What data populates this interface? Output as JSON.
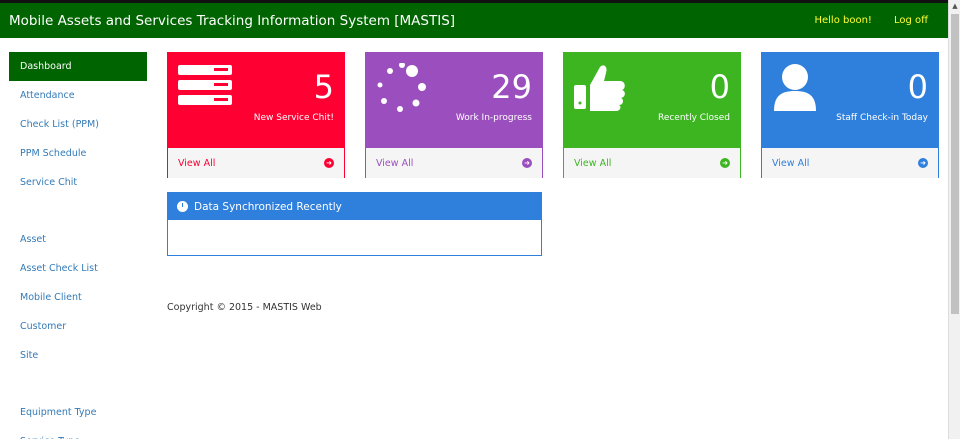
{
  "header": {
    "title": "Mobile Assets and Services Tracking Information System [MASTIS]",
    "greeting": "Hello boon!",
    "logout": "Log off"
  },
  "sidebar": {
    "group1": [
      "Dashboard",
      "Attendance",
      "Check List (PPM)",
      "PPM Schedule",
      "Service Chit"
    ],
    "group2": [
      "Asset",
      "Asset Check List",
      "Mobile Client",
      "Customer",
      "Site"
    ],
    "group3": [
      "Equipment Type",
      "Service Type"
    ]
  },
  "cards": [
    {
      "value": "5",
      "label": "New Service Chit!",
      "link": "View All",
      "color": "#ff0033",
      "icon": "list-icon"
    },
    {
      "value": "29",
      "label": "Work In-progress",
      "link": "View All",
      "color": "#9b4fbf",
      "icon": "spinner-icon"
    },
    {
      "value": "0",
      "label": "Recently Closed",
      "link": "View All",
      "color": "#3cb521",
      "icon": "thumbs-up-icon"
    },
    {
      "value": "0",
      "label": "Staff Check-in Today",
      "link": "View All",
      "color": "#2f7fdc",
      "icon": "user-icon"
    }
  ],
  "sync": {
    "title": "Data Synchronized Recently"
  },
  "footer": {
    "copyright": "Copyright © 2015 - MASTIS Web"
  }
}
